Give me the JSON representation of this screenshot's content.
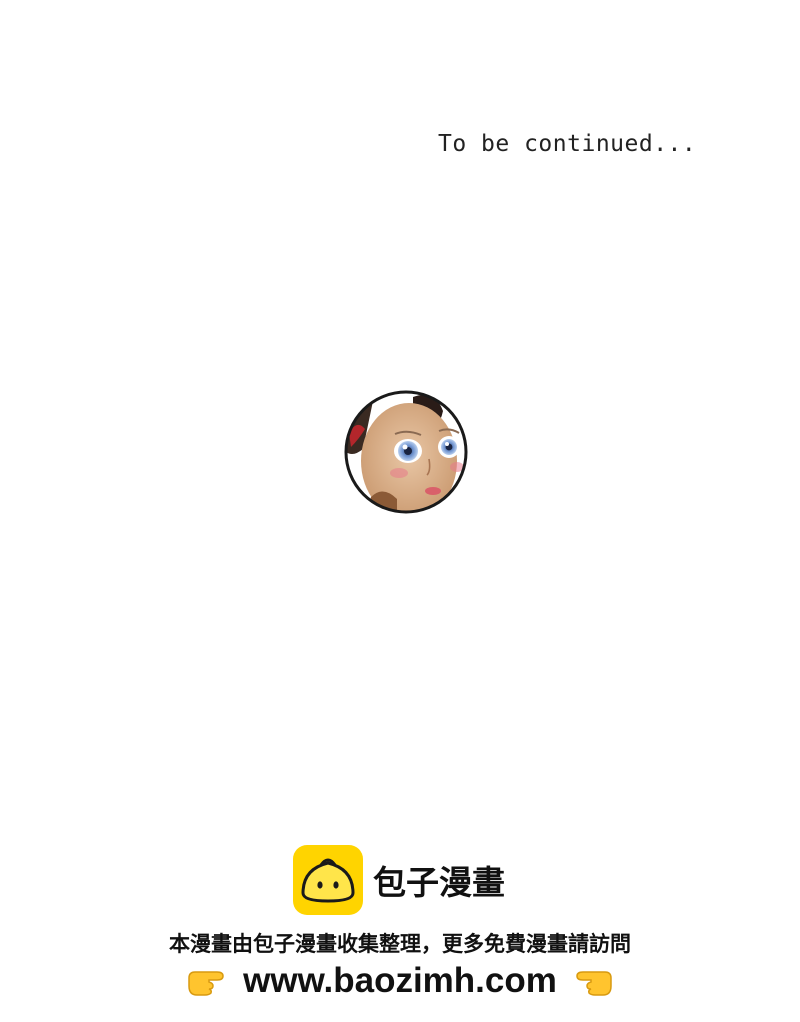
{
  "page": {
    "continued_text": "To be continued..."
  },
  "footer": {
    "brand_name": "包子漫畫",
    "notice": "本漫畫由包子漫畫收集整理，更多免費漫畫請訪問",
    "url": "www.baozimh.com",
    "logo_icon": "baozi-bun-icon",
    "pointer_icons": [
      "pointing-right-hand-icon",
      "pointing-left-hand-icon"
    ],
    "logo_color": "#FFD400"
  }
}
